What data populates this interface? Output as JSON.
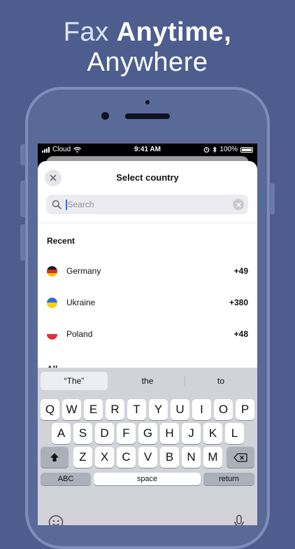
{
  "headline": {
    "line1_light": "Fax",
    "line1_bold": "Anytime,",
    "line2": "Anywhere"
  },
  "status_bar": {
    "carrier": "Cloud",
    "time": "9:41 AM",
    "battery": "100%"
  },
  "modal": {
    "title": "Select country",
    "search_placeholder": "Search",
    "recent_label": "Recent",
    "all_label": "All",
    "recent": [
      {
        "name": "Germany",
        "code": "+49",
        "flag": [
          "#1a1a1a",
          "#dd2b2b",
          "#f5c200"
        ]
      },
      {
        "name": "Ukraine",
        "code": "+380",
        "flag": [
          "#2f6fd6",
          "#f8d310"
        ]
      },
      {
        "name": "Poland",
        "code": "+48",
        "flag": [
          "#ffffff",
          "#e0303c"
        ]
      }
    ]
  },
  "keyboard": {
    "suggestions": [
      "“The”",
      "the",
      "to"
    ],
    "row1": [
      "Q",
      "W",
      "E",
      "R",
      "T",
      "Y",
      "U",
      "I",
      "O",
      "P"
    ],
    "row2": [
      "A",
      "S",
      "D",
      "F",
      "G",
      "H",
      "J",
      "K",
      "L"
    ],
    "row3": [
      "Z",
      "X",
      "C",
      "V",
      "B",
      "N",
      "M"
    ],
    "abc_label": "ABC",
    "space_label": "space",
    "return_label": "return"
  },
  "colors": {
    "background": "#4d5e8e",
    "accent_caret": "#2b6df5"
  }
}
